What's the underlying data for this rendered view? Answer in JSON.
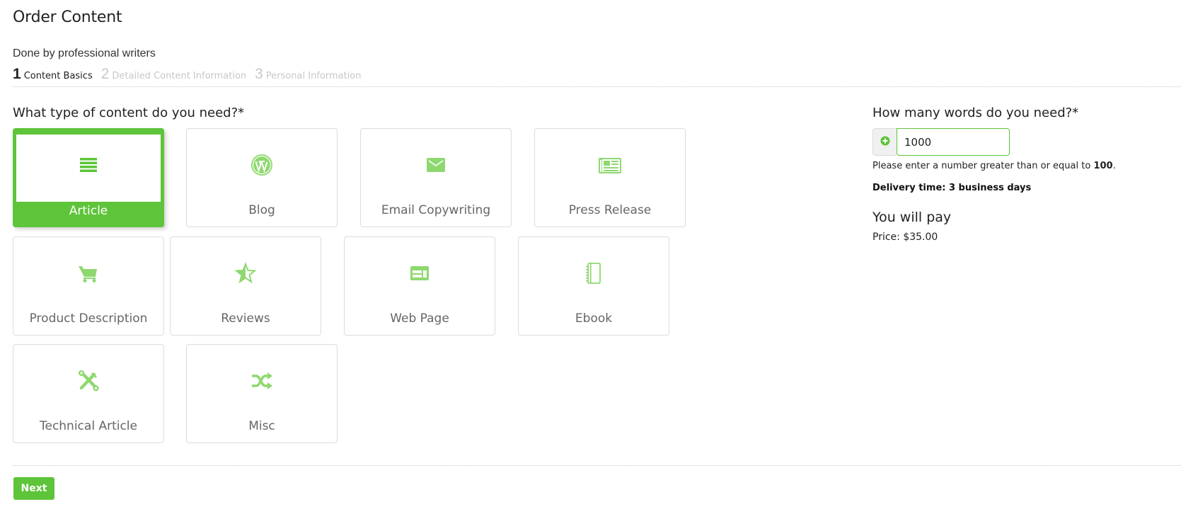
{
  "header": {
    "title": "Order Content",
    "subtitle": "Done by professional writers"
  },
  "steps": [
    {
      "number": "1",
      "label": "Content Basics",
      "active": true
    },
    {
      "number": "2",
      "label": "Detailed Content Information",
      "active": false
    },
    {
      "number": "3",
      "label": "Personal Information",
      "active": false
    }
  ],
  "content_type": {
    "question": "What type of content do you need?*",
    "selected": "Article",
    "options": [
      {
        "label": "Article",
        "icon": "list-lines-icon"
      },
      {
        "label": "Blog",
        "icon": "wordpress-icon"
      },
      {
        "label": "Email Copywriting",
        "icon": "envelope-icon"
      },
      {
        "label": "Press Release",
        "icon": "newspaper-icon"
      },
      {
        "label": "Product Description",
        "icon": "shopping-cart-icon"
      },
      {
        "label": "Reviews",
        "icon": "half-star-icon"
      },
      {
        "label": "Web Page",
        "icon": "web-layout-icon"
      },
      {
        "label": "Ebook",
        "icon": "notebook-icon"
      },
      {
        "label": "Technical Article",
        "icon": "wrench-screwdriver-icon"
      },
      {
        "label": "Misc",
        "icon": "shuffle-icon"
      }
    ]
  },
  "words": {
    "question": "How many words do you need?*",
    "value": "1000",
    "hint_prefix": "Please enter a number greater than or equal to ",
    "hint_min": "100",
    "hint_suffix": ".",
    "delivery": "Delivery time: 3 business days"
  },
  "payment": {
    "title": "You will pay",
    "price": "Price: $35.00"
  },
  "footer": {
    "next_label": "Next"
  },
  "colors": {
    "accent": "#5ec43a",
    "icon": "#8fd870",
    "inactive_step": "#c8c8c8"
  }
}
